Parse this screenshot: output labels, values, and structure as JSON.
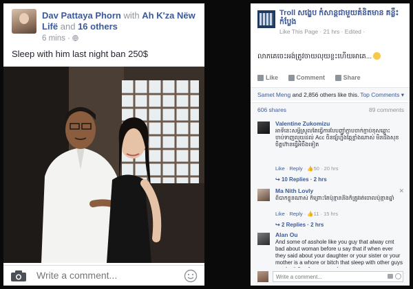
{
  "left_post": {
    "author": "Dav Pattaya Phorn",
    "with_word": "with",
    "tagged": "Ah K'za Nëw Lifë",
    "and_word": "and",
    "others": "16 others",
    "time": "6 mins",
    "audience_icon": "globe-icon",
    "status_text": "Sleep with him last night ban 250$",
    "comment_placeholder": "Write a comment...",
    "camera_icon": "camera-icon",
    "smiley_icon": "smiley-icon"
  },
  "right_post": {
    "page_name": "Troll សង្ខេប កំសាន្តជាមួយគំនិតមាន​ គន្លឹះ កំប្លែង",
    "page_meta": "Like This Page · 21 hrs · Edited ·",
    "post_text": "លាភ​គេ​ចេះ​អង់​ត្រូវ​ចាយ​លុយ​ខ្លះ​ហើយ​អា​គេ​...",
    "actions": {
      "like": "Like",
      "comment": "Comment",
      "share": "Share"
    },
    "likes_name": "Samet Meng",
    "likes_rest": "and 2,856 others like this.",
    "top_comments": "Top Comments ▾",
    "shares": "606 shares",
    "comments_count": "89 comments",
    "comments": [
      {
        "name": "Valentine Zukomizu",
        "text": "អាទីនេះសម្ដីស្រួលតែធ្វើការបែប​ញ៉ាំក្តាប​ចាក់​ភ្ជាប់​ខុស​ឆ្ពោះ​ចាប់ទាញ​លុយ​ដល់ Acc ចិន​ផ្សំ​ហ្នឹង​ឆ្កែ​ខ្លាំង​ណាស់ មិនដឹង​សុខចិត្ត​ហ៊ាន​ធ្វើ​អីចឹង​ទៀត",
        "meta_like": "Like",
        "meta_reply": "Reply",
        "meta_count": "50",
        "meta_time": "20 hrs",
        "replies": "10 Replies · 2 hrs"
      },
      {
        "name": "Ma Nith Lovly",
        "text": "ពិបាកខ្លួនណាស់ ក៏ព្រោះតែប៉ុន្មាននឹងក៏ត្រូវ​រត់​ចោល​ប៉ុន្មាន​ឆ្នាំ",
        "meta_like": "Like",
        "meta_reply": "Reply",
        "meta_count": "11",
        "meta_time": "15 hrs",
        "replies": "2 Replies · 2 hrs"
      },
      {
        "name": "Alan Ou",
        "text": "And some of asshole like you guy that alway cmt bad about woman before u say that if when ever they said about your daughter or your sister or your mother is a whore or bitch that sleep with other guys maybe it fine for you guy becuz u"
      }
    ],
    "write_placeholder": "Write a comment..."
  }
}
